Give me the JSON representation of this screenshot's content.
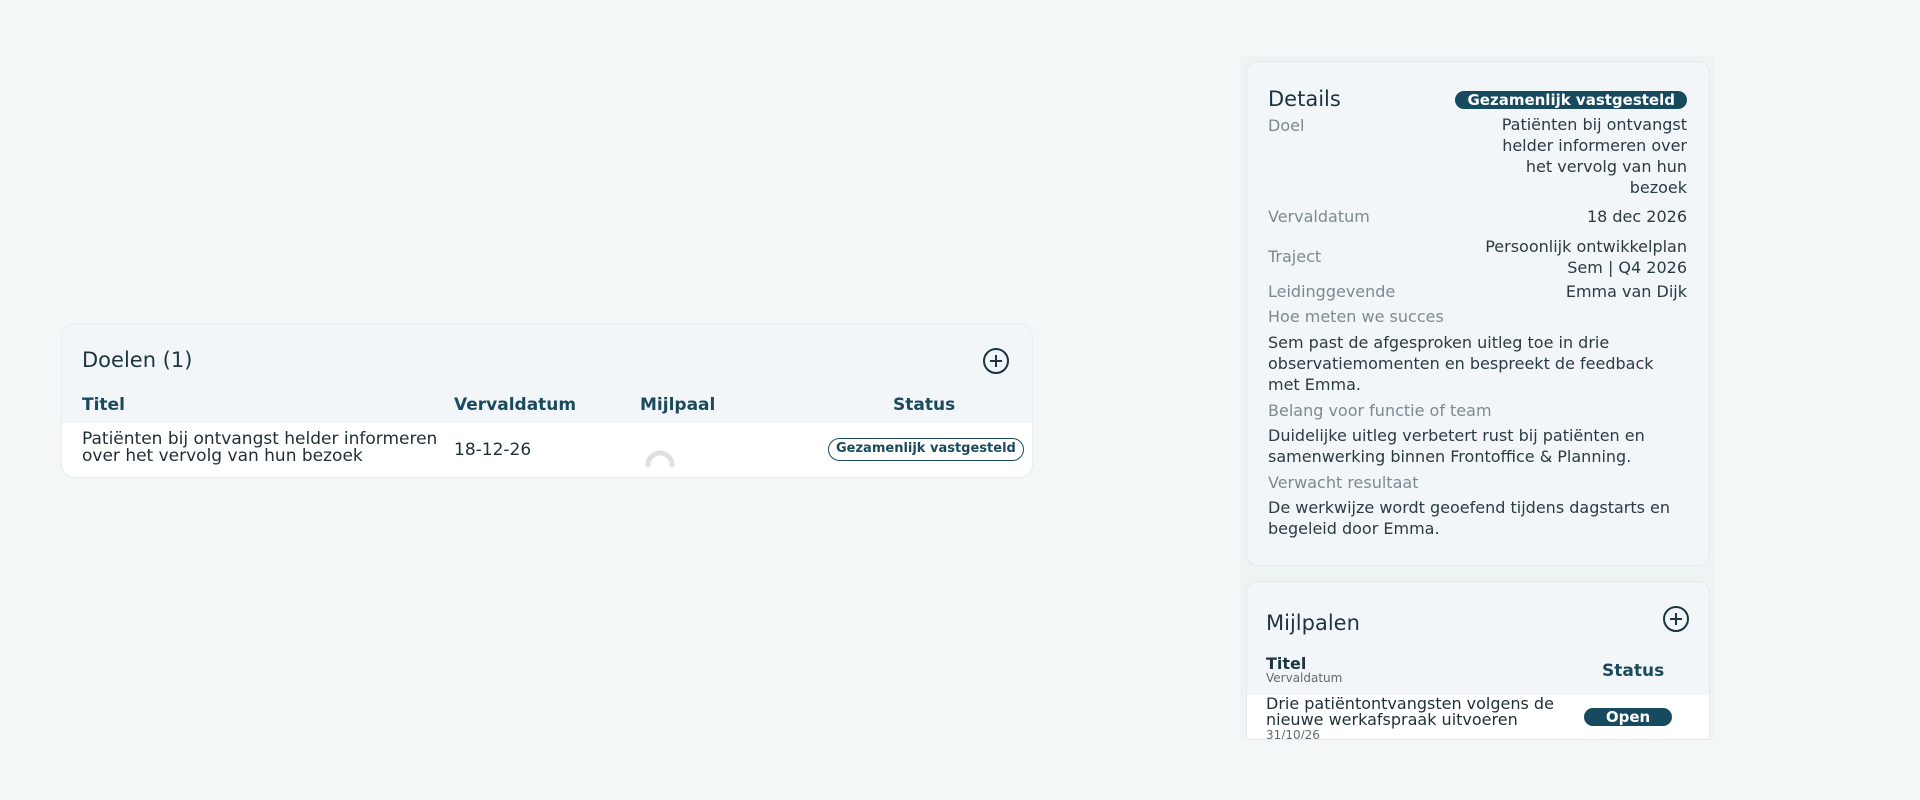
{
  "goals": {
    "title": "Doelen (1)",
    "add_icon": "plus-circle-icon",
    "columns": {
      "title": "Titel",
      "due_date": "Vervaldatum",
      "milestone": "Mijlpaal",
      "status": "Status"
    },
    "rows": [
      {
        "title": "Patiënten bij ontvangst helder informeren over het vervolg van hun bezoek",
        "due_date": "18-12-26",
        "status": "Gezamenlijk vastgesteld"
      }
    ]
  },
  "details": {
    "title": "Details",
    "status_badge": "Gezamenlijk vastgesteld",
    "goal_label": "Doel",
    "goal_value": "Patiënten bij ontvangst helder informeren over het vervolg van hun bezoek",
    "due_label": "Vervaldatum",
    "due_value": "18 dec 2026",
    "track_label": "Traject",
    "track_value_line1": "Persoonlijk ontwikkelplan",
    "track_value_line2": "Sem | Q4 2026",
    "manager_label": "Leidinggevende",
    "manager_value": "Emma van Dijk",
    "success_label": "Hoe meten we succes",
    "success_text": "Sem past de afgesproken uitleg toe in drie observatiemomenten en bespreekt de feedback met Emma.",
    "importance_label": "Belang voor functie of team",
    "importance_text": "Duidelijke uitleg verbetert rust bij patiënten en samenwerking binnen Frontoffice & Planning.",
    "result_label": "Verwacht resultaat",
    "result_text": "De werkwijze wordt geoefend tijdens dagstarts en begeleid door Emma."
  },
  "milestones": {
    "title": "Mijlpalen",
    "add_icon": "plus-circle-icon",
    "col_title": "Titel",
    "col_due": "Vervaldatum",
    "col_status": "Status",
    "rows": [
      {
        "title": "Drie patiëntontvangsten volgens de nieuwe werkafspraak uitvoeren",
        "due": "31/10/26",
        "status": "Open"
      }
    ]
  },
  "colors": {
    "accent": "#174a5e",
    "background": "#f3f7f7",
    "card": "#f2f6f8"
  }
}
